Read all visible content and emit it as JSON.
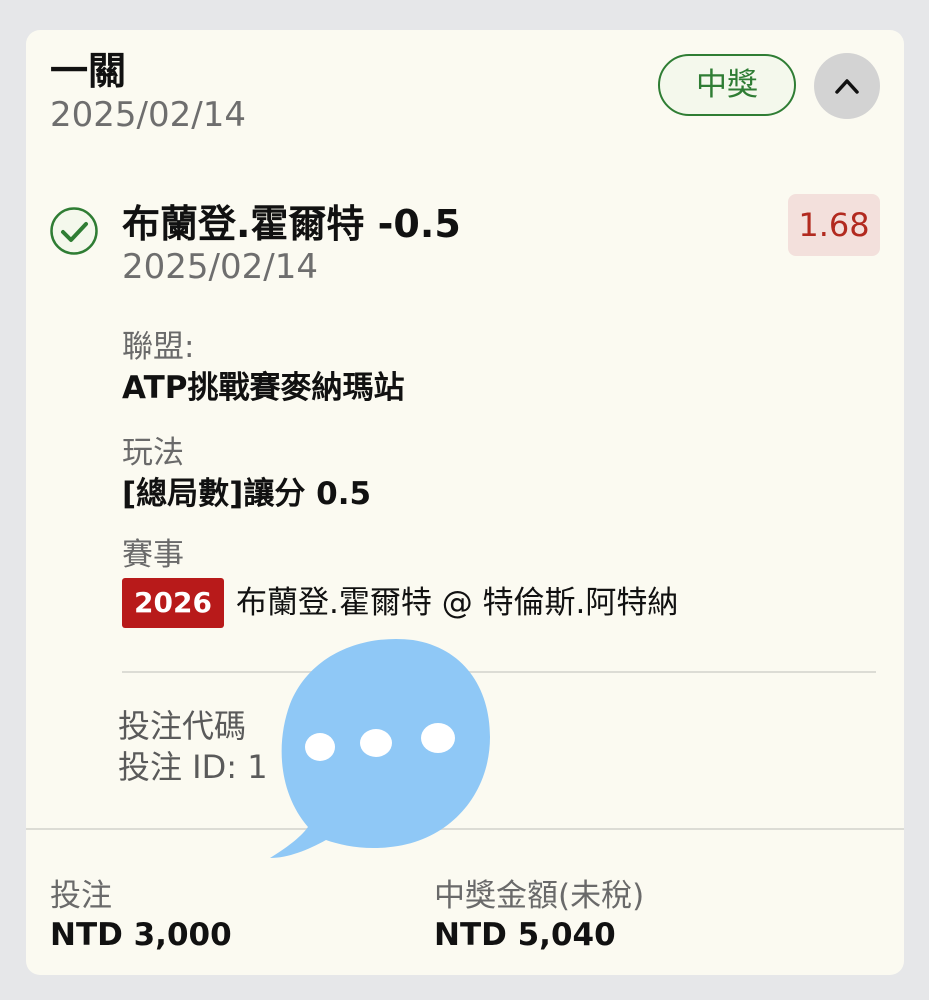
{
  "header": {
    "title": "一關",
    "date": "2025/02/14",
    "status_badge": "中獎",
    "collapse_icon": "chevron-up-icon"
  },
  "selection": {
    "status_icon": "check-circle-icon",
    "name": "布蘭登.霍爾特 -0.5",
    "date": "2025/02/14",
    "odds": "1.68",
    "league_label": "聯盟:",
    "league_value": "ATP挑戰賽麥納瑪站",
    "market_label": "玩法",
    "market_value": "[總局數]讓分 0.5",
    "event_label": "賽事",
    "event_year_badge": "2026",
    "event_match": "布蘭登.霍爾特 @ 特倫斯.阿特納"
  },
  "bet_info": {
    "code_label": "投注代碼",
    "id_label": "投注 ID: 1"
  },
  "footer": {
    "stake_label": "投注",
    "stake_value": "NTD 3,000",
    "payout_label": "中獎金額(未稅)",
    "payout_value": "NTD 5,040"
  },
  "overlay": {
    "icon": "chat-bubble-icon"
  },
  "colors": {
    "win_green": "#2f7d34",
    "odds_red": "#b22a1f",
    "badge_red": "#b81a1a",
    "card_bg": "#fbfaf1",
    "page_bg": "#e6e7e9",
    "chat_blue": "#8fc8f6"
  }
}
